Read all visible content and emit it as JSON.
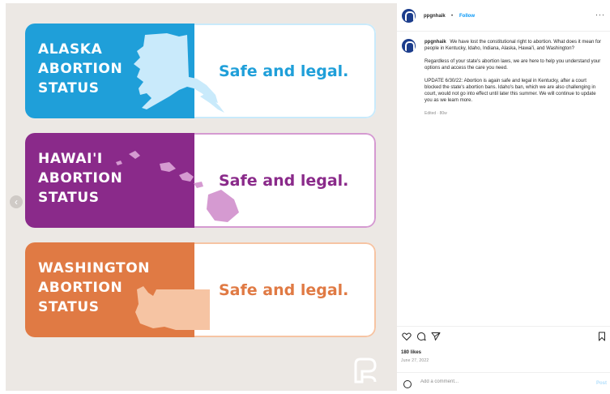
{
  "colors": {
    "alaska_blue": "#1f9fd9",
    "alaska_map": "#c9eafb",
    "alaska_text": "#1f9fd9",
    "hawaii_purple": "#8a2a8a",
    "hawaii_map": "#d59ad1",
    "hawaii_text": "#8a2a8a",
    "washington_orange": "#e07a44",
    "washington_map": "#f6c4a3",
    "washington_text": "#e07a44",
    "follow_blue": "#0095f6"
  },
  "post": {
    "cards": [
      {
        "title_lines": [
          "ALASKA",
          "ABORTION",
          "STATUS"
        ],
        "tagline": "Safe and legal."
      },
      {
        "title_lines": [
          "HAWAI'I",
          "ABORTION",
          "STATUS"
        ],
        "tagline": "Safe and legal."
      },
      {
        "title_lines": [
          "WASHINGTON",
          "ABORTION",
          "STATUS"
        ],
        "tagline": "Safe and legal."
      }
    ]
  },
  "header": {
    "username": "ppgnhaik",
    "separator": "•",
    "follow_label": "Follow",
    "more_label": "···"
  },
  "caption": {
    "username": "ppgnhaik",
    "text": "We have lost the constitutional right to abortion. What does it mean for people in Kentucky, Idaho, Indiana, Alaska, Hawai'i, and Washington?",
    "paragraph2": "Regardless of your state's abortion laws, we are here to help you understand your options and access the care you need.",
    "paragraph3": "UPDATE 6/30/22: Abortion is again safe and legal in Kentucky, after a court blocked the state's abortion bans. Idaho's ban, which we are also challenging in court, would not go into effect until later this summer. We will continue to update you as we learn more.",
    "edited": "Edited · 80w"
  },
  "engagement": {
    "likes": "180 likes",
    "date": "June 27, 2022"
  },
  "comment": {
    "placeholder": "Add a comment...",
    "post_label": "Post"
  },
  "icons": {
    "prev": "chevron-left-icon",
    "like": "heart-icon",
    "comment": "comment-icon",
    "share": "share-icon",
    "save": "bookmark-icon",
    "emoji": "emoji-icon",
    "brand": "planned-parenthood-logo"
  }
}
